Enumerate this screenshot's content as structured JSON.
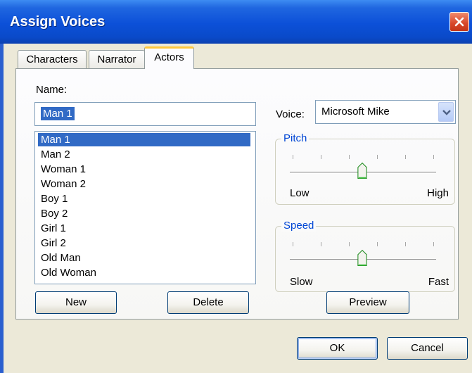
{
  "window": {
    "title": "Assign Voices",
    "close_icon": "close-icon"
  },
  "tabs": [
    {
      "label": "Characters",
      "active": false
    },
    {
      "label": "Narrator",
      "active": false
    },
    {
      "label": "Actors",
      "active": true
    }
  ],
  "actors": {
    "name_label": "Name:",
    "name_value": "Man 1",
    "list": [
      {
        "label": "Man 1",
        "selected": true
      },
      {
        "label": "Man 2",
        "selected": false
      },
      {
        "label": "Woman 1",
        "selected": false
      },
      {
        "label": "Woman 2",
        "selected": false
      },
      {
        "label": "Boy 1",
        "selected": false
      },
      {
        "label": "Boy 2",
        "selected": false
      },
      {
        "label": "Girl 1",
        "selected": false
      },
      {
        "label": "Girl 2",
        "selected": false
      },
      {
        "label": "Old Man",
        "selected": false
      },
      {
        "label": "Old Woman",
        "selected": false
      }
    ],
    "new_label": "New",
    "delete_label": "Delete"
  },
  "voice": {
    "label": "Voice:",
    "selected": "Microsoft Mike"
  },
  "pitch": {
    "title": "Pitch",
    "low_label": "Low",
    "high_label": "High",
    "value_fraction": 0.5,
    "tick_count": 6
  },
  "speed": {
    "title": "Speed",
    "low_label": "Slow",
    "high_label": "Fast",
    "value_fraction": 0.5,
    "tick_count": 6
  },
  "preview_label": "Preview",
  "footer": {
    "ok_label": "OK",
    "cancel_label": "Cancel"
  },
  "colors": {
    "titlebar": "#0a4ac9",
    "selection": "#316ac5",
    "group_title": "#0046d5",
    "dialog_bg": "#ece9d8"
  }
}
